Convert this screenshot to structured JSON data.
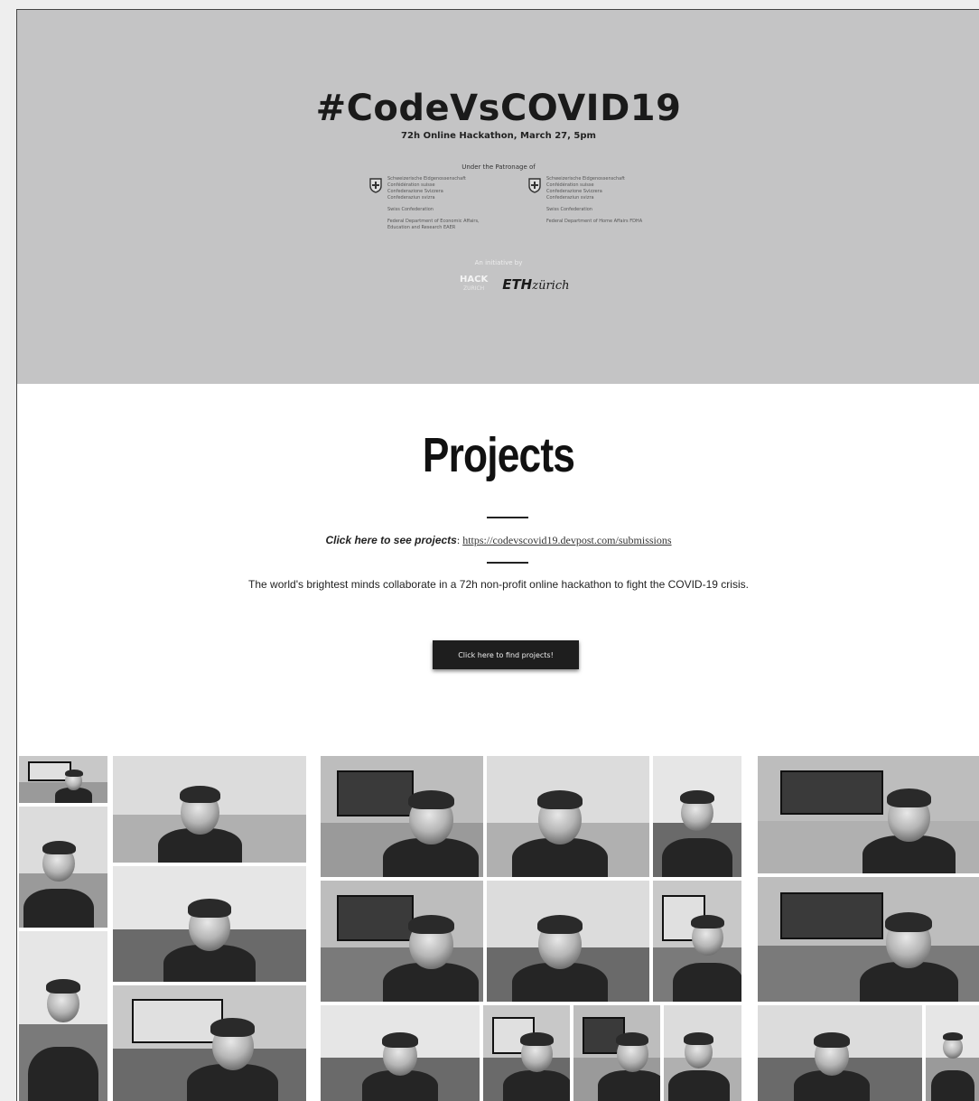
{
  "hero": {
    "title": "#CodeVsCOVID19",
    "subtitle": "72h Online Hackathon, March 27, 5pm",
    "patronage": "Under the Patronage of",
    "org_left": [
      "Schweizerische Eidgenossenschaft",
      "Confédération suisse",
      "Confederazione Svizzera",
      "Confederaziun svizra"
    ],
    "org_left_2": "Swiss Confederation",
    "org_left_3": [
      "Federal Department of Economic Affairs,",
      "Education and Research EAER"
    ],
    "org_right": [
      "Schweizerische Eidgenossenschaft",
      "Confédération suisse",
      "Confederazione Svizzera",
      "Confederaziun svizra"
    ],
    "org_right_2": "Swiss Confederation",
    "org_right_3": "Federal Department of Home Affairs FDHA",
    "initiative": "An initiative by",
    "hack_logo_main": "HACK",
    "hack_logo_small": "ZURICH",
    "eth_bold": "ETH",
    "eth_rest": "zürich"
  },
  "projects": {
    "title": "Projects",
    "click_label": "Click here to see projects",
    "click_sep": ": ",
    "link": "https://codevscovid19.devpost.com/submissions",
    "tagline": "The world's brightest minds collaborate  in a 72h non-profit online hackathon to fight the COVID-19 crisis.",
    "cta": "Click here to find projects!"
  },
  "colors": {
    "hero_bg": "#c4c4c5",
    "cta_bg": "#1e1e1e"
  }
}
